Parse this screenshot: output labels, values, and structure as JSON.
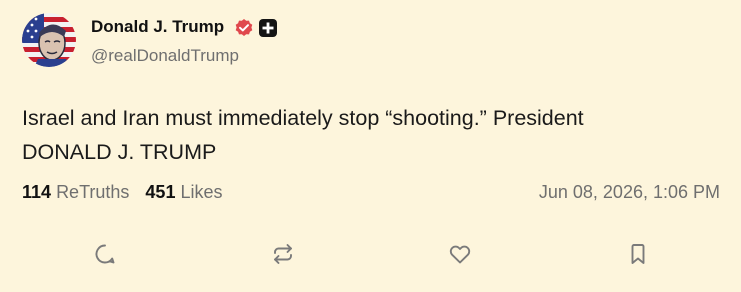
{
  "post": {
    "author": {
      "display_name": "Donald J. Trump",
      "handle": "@realDonaldTrump",
      "verified_icon": "verified-badge-icon",
      "plus_icon": "plus-badge-icon"
    },
    "text_line_1": "Israel and Iran must immediately stop “shooting.” President",
    "text_line_2": "DONALD J. TRUMP",
    "stats": {
      "retruths_count": "114",
      "retruths_label": "ReTruths",
      "likes_count": "451",
      "likes_label": "Likes"
    },
    "timestamp": "Jun 08, 2026, 1:06 PM",
    "actions": [
      {
        "name": "reply",
        "icon": "comment-icon"
      },
      {
        "name": "retruth",
        "icon": "repost-icon"
      },
      {
        "name": "like",
        "icon": "heart-icon"
      },
      {
        "name": "bookmark",
        "icon": "bookmark-icon"
      }
    ]
  },
  "colors": {
    "background": "#fdf5dc",
    "text": "#1a1a1a",
    "muted": "#6f6f6f",
    "verified": "#e0484d",
    "icon": "#7a7a7a"
  }
}
